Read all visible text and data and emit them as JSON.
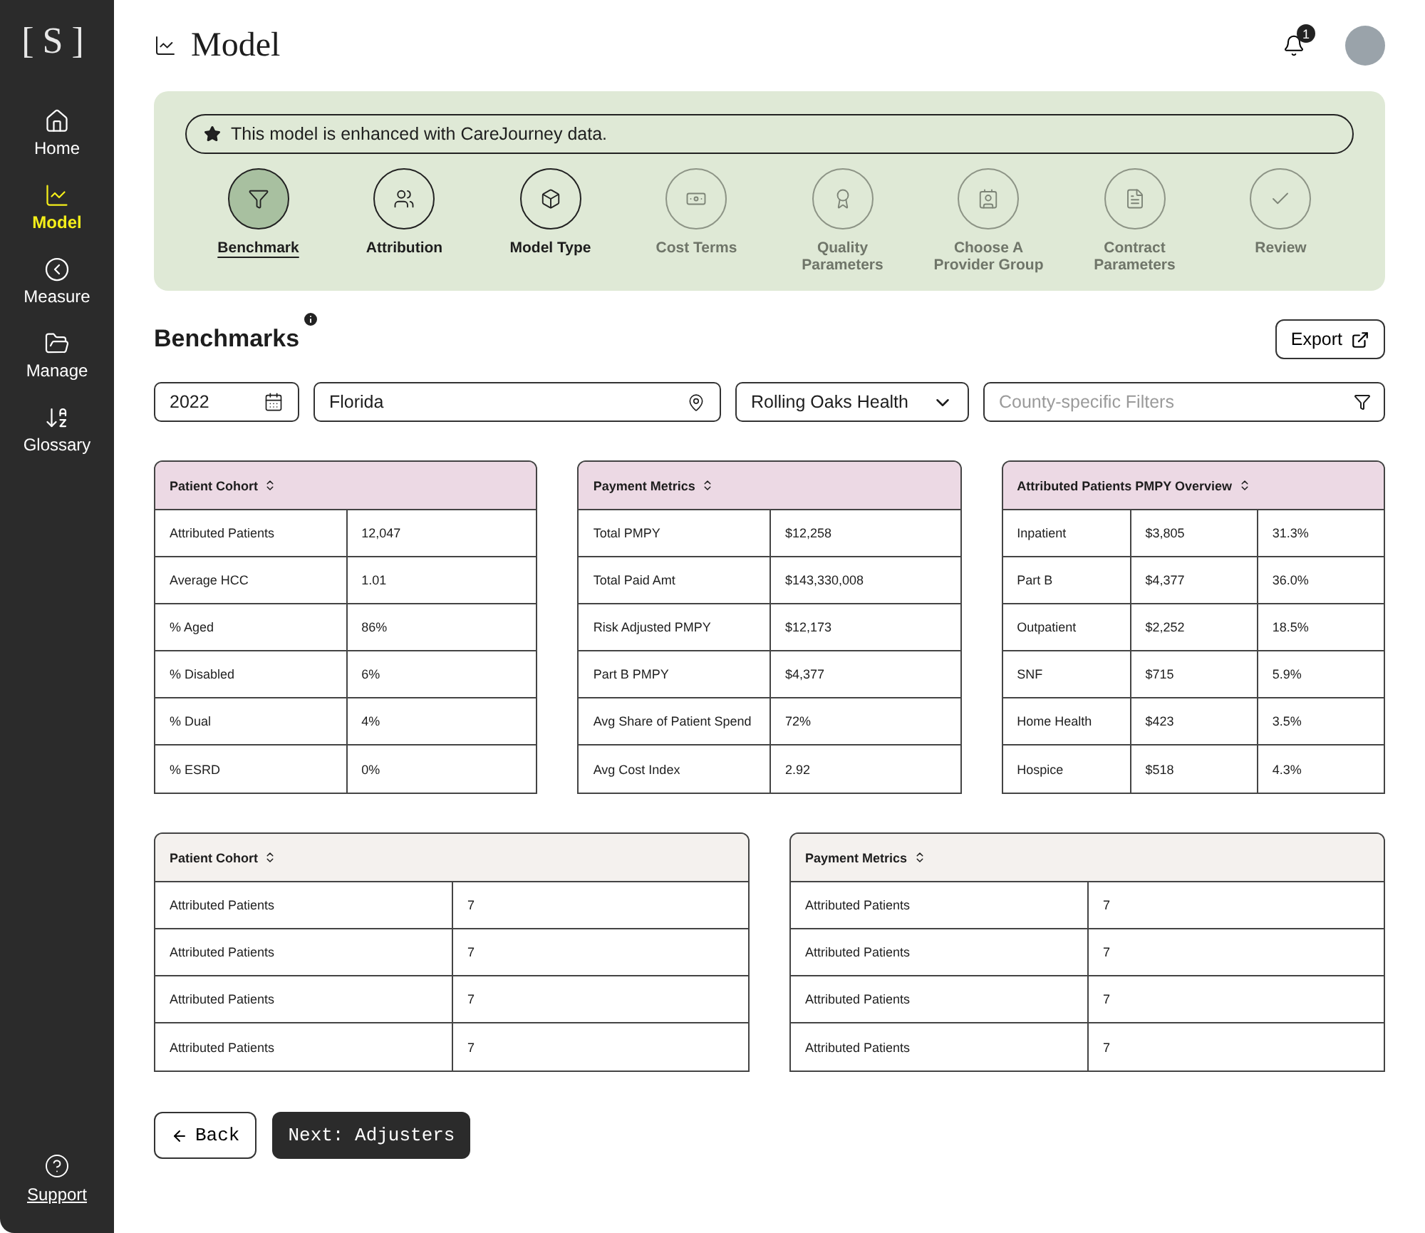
{
  "sidebar": {
    "logo": "[S]",
    "items": [
      {
        "label": "Home",
        "selected": false
      },
      {
        "label": "Model",
        "selected": true
      },
      {
        "label": "Measure",
        "selected": false
      },
      {
        "label": "Manage",
        "selected": false
      },
      {
        "label": "Glossary",
        "selected": false
      }
    ],
    "support": "Support"
  },
  "header": {
    "title": "Model",
    "notification_count": "1"
  },
  "banner": {
    "text": "This model is enhanced with CareJourney data."
  },
  "steps": [
    {
      "label": "Benchmark",
      "selected": true,
      "disabled": false
    },
    {
      "label": "Attribution",
      "selected": false,
      "disabled": false
    },
    {
      "label": "Model Type",
      "selected": false,
      "disabled": false
    },
    {
      "label": "Cost Terms",
      "selected": false,
      "disabled": true
    },
    {
      "label": "Quality Parameters",
      "selected": false,
      "disabled": true
    },
    {
      "label": "Choose A Provider Group",
      "selected": false,
      "disabled": true
    },
    {
      "label": "Contract Parameters",
      "selected": false,
      "disabled": true
    },
    {
      "label": "Review",
      "selected": false,
      "disabled": true
    }
  ],
  "section": {
    "title": "Benchmarks",
    "export": "Export"
  },
  "filters": {
    "year": "2022",
    "location": "Florida",
    "organization": "Rolling Oaks Health",
    "county_placeholder": "County-specific Filters"
  },
  "summary_tables": [
    {
      "title": "Patient Cohort",
      "color": "#ecd9e4",
      "rows": [
        [
          "Attributed Patients",
          "12,047"
        ],
        [
          "Average HCC",
          "1.01"
        ],
        [
          "% Aged",
          "86%"
        ],
        [
          "% Disabled",
          "6%"
        ],
        [
          "% Dual",
          "4%"
        ],
        [
          "% ESRD",
          "0%"
        ]
      ]
    },
    {
      "title": "Payment Metrics",
      "color": "#ecd9e4",
      "rows": [
        [
          "Total PMPY",
          "$12,258"
        ],
        [
          "Total Paid Amt",
          "$143,330,008"
        ],
        [
          "Risk Adjusted PMPY",
          "$12,173"
        ],
        [
          "Part B PMPY",
          "$4,377"
        ],
        [
          "Avg Share of Patient Spend",
          "72%"
        ],
        [
          "Avg Cost Index",
          "2.92"
        ]
      ]
    },
    {
      "title": "Attributed Patients PMPY Overview",
      "color": "#ecd9e4",
      "rows": [
        [
          "Inpatient",
          "$3,805",
          "31.3%"
        ],
        [
          "Part B",
          "$4,377",
          "36.0%"
        ],
        [
          "Outpatient",
          "$2,252",
          "18.5%"
        ],
        [
          "SNF",
          "$715",
          "5.9%"
        ],
        [
          "Home Health",
          "$423",
          "3.5%"
        ],
        [
          "Hospice",
          "$518",
          "4.3%"
        ]
      ]
    }
  ],
  "detail_tables": [
    {
      "title": "Patient Cohort",
      "color": "#f4f1ee",
      "rows": [
        [
          "Attributed Patients",
          "7"
        ],
        [
          "Attributed Patients",
          "7"
        ],
        [
          "Attributed Patients",
          "7"
        ],
        [
          "Attributed Patients",
          "7"
        ]
      ]
    },
    {
      "title": "Payment Metrics",
      "color": "#f4f1ee",
      "rows": [
        [
          "Attributed Patients",
          "7"
        ],
        [
          "Attributed Patients",
          "7"
        ],
        [
          "Attributed Patients",
          "7"
        ],
        [
          "Attributed Patients",
          "7"
        ]
      ]
    }
  ],
  "buttons": {
    "back": "Back",
    "next": "Next: Adjusters"
  }
}
